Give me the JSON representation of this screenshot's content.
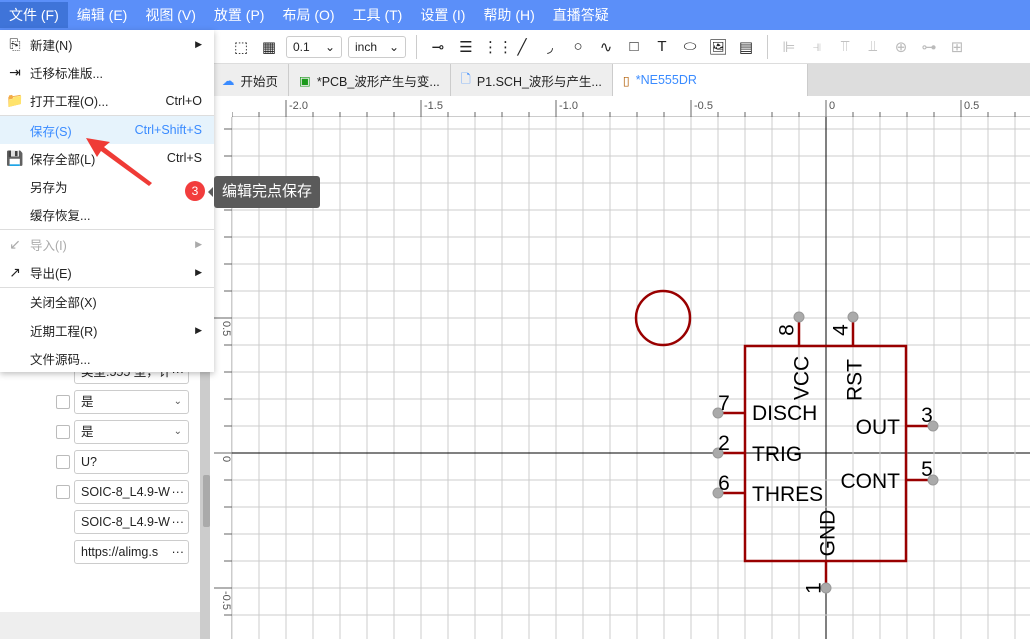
{
  "menubar": [
    {
      "label": "文件 (F)",
      "active": true
    },
    {
      "label": "编辑 (E)"
    },
    {
      "label": "视图 (V)"
    },
    {
      "label": "放置 (P)"
    },
    {
      "label": "布局 (O)"
    },
    {
      "label": "工具 (T)"
    },
    {
      "label": "设置 (I)"
    },
    {
      "label": "帮助 (H)"
    },
    {
      "label": "直播答疑"
    }
  ],
  "toolbar": {
    "grid_value": "0.1",
    "unit": "inch"
  },
  "tabs": [
    {
      "label": "开始页",
      "icon": "cloud-icon"
    },
    {
      "label": "*PCB_波形产生与变...",
      "icon": "pcb-icon"
    },
    {
      "label": "P1.SCH_波形与产生...",
      "icon": "document-icon"
    },
    {
      "label": "*NE555DR",
      "icon": "chip-icon",
      "active": true
    }
  ],
  "file_menu": [
    {
      "label": "新建(N)",
      "icon": "new-file-icon",
      "submenu": true
    },
    {
      "label": "迁移标准版...",
      "icon": "migrate-icon"
    },
    {
      "label": "打开工程(O)...",
      "icon": "folder-icon",
      "shortcut": "Ctrl+O"
    },
    {
      "label": "保存(S)",
      "shortcut": "Ctrl+Shift+S",
      "highlighted": true
    },
    {
      "label": "保存全部(L)",
      "icon": "save-icon",
      "shortcut": "Ctrl+S"
    },
    {
      "label": "另存为"
    },
    {
      "label": "缓存恢复..."
    },
    {
      "label": "导入(I)",
      "icon": "import-icon",
      "submenu": true,
      "disabled": true
    },
    {
      "label": "导出(E)",
      "icon": "export-icon",
      "submenu": true
    },
    {
      "label": "关闭全部(X)"
    },
    {
      "label": "近期工程(R)",
      "submenu": true
    },
    {
      "label": "文件源码..."
    }
  ],
  "annotation": {
    "step": "3",
    "text": "编辑完点保存",
    "color": "#f23d3d"
  },
  "properties": [
    {
      "value": "",
      "checkbox": false,
      "type": "text"
    },
    {
      "value": "类型:555 型，计",
      "checkbox": false,
      "type": "more"
    },
    {
      "value": "是",
      "checkbox": true,
      "type": "select"
    },
    {
      "value": "是",
      "checkbox": true,
      "type": "select"
    },
    {
      "value": "U?",
      "checkbox": true,
      "type": "text"
    },
    {
      "value": "SOIC-8_L4.9-W",
      "checkbox": true,
      "type": "more"
    },
    {
      "value": "SOIC-8_L4.9-W",
      "checkbox": false,
      "type": "more"
    },
    {
      "value": "https://alimg.s",
      "checkbox": false,
      "type": "more"
    }
  ],
  "rulers": {
    "h": [
      "-2.0",
      "-1.5",
      "-1.0",
      "-0.5",
      "0",
      "0.5"
    ],
    "v": [
      "0.5",
      "0",
      "-0.5"
    ]
  },
  "symbol": {
    "color": "#990000",
    "pins": [
      {
        "num": "8",
        "name": "VCC"
      },
      {
        "num": "4",
        "name": "RST"
      },
      {
        "num": "7",
        "name": "DISCH"
      },
      {
        "num": "2",
        "name": "TRIG"
      },
      {
        "num": "6",
        "name": "THRES"
      },
      {
        "num": "3",
        "name": "OUT"
      },
      {
        "num": "5",
        "name": "CONT"
      },
      {
        "num": "1",
        "name": "GND"
      }
    ]
  }
}
